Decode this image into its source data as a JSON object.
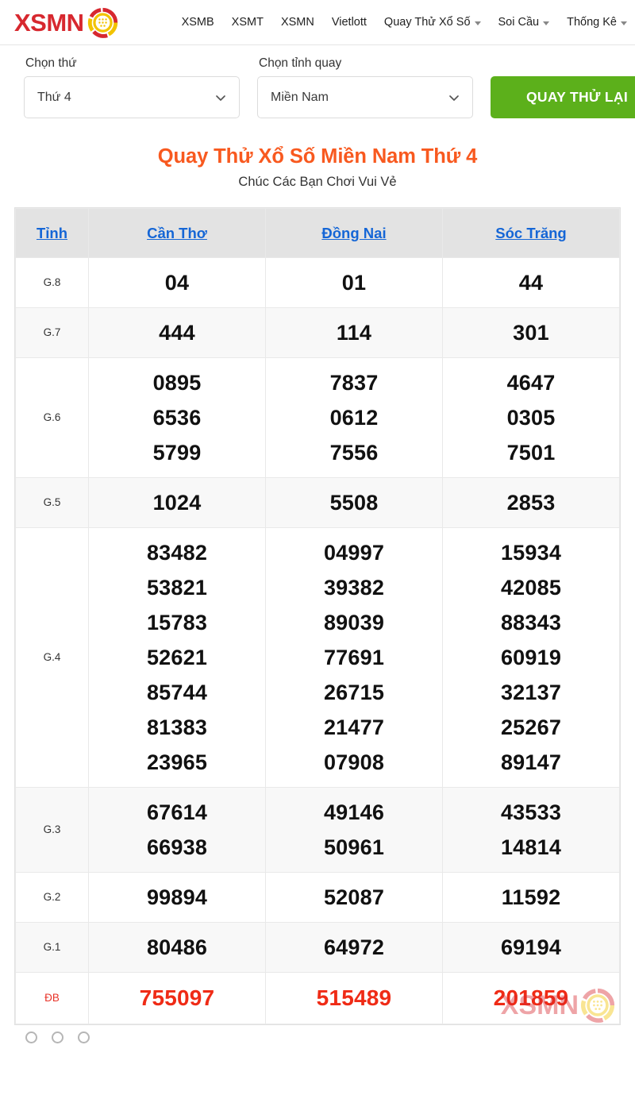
{
  "header": {
    "logo_text": "XSMN",
    "logo_icon": "lottery-ball-icon",
    "nav": [
      {
        "label": "XSMB",
        "has_caret": false
      },
      {
        "label": "XSMT",
        "has_caret": false
      },
      {
        "label": "XSMN",
        "has_caret": false
      },
      {
        "label": "Vietlott",
        "has_caret": false
      },
      {
        "label": "Quay Thử Xổ Số",
        "has_caret": true
      },
      {
        "label": "Soi Cầu",
        "has_caret": true
      },
      {
        "label": "Thống Kê",
        "has_caret": true
      }
    ]
  },
  "filters": {
    "day": {
      "label": "Chọn thứ",
      "value": "Thứ 4",
      "icon": "chevron-down-icon"
    },
    "province": {
      "label": "Chọn tỉnh quay",
      "value": "Miền Nam",
      "icon": "chevron-down-icon"
    },
    "spin_button": "QUAY THỬ LẠI"
  },
  "page": {
    "title": "Quay Thử Xổ Số Miền Nam Thứ 4",
    "subtitle": "Chúc Các Bạn Chơi Vui Vẻ"
  },
  "results_table": {
    "headers": [
      "Tỉnh",
      "Cần Thơ",
      "Đồng Nai",
      "Sóc Trăng"
    ],
    "rows": [
      {
        "prize": "G.8",
        "values": [
          [
            "04"
          ],
          [
            "01"
          ],
          [
            "44"
          ]
        ]
      },
      {
        "prize": "G.7",
        "values": [
          [
            "444"
          ],
          [
            "114"
          ],
          [
            "301"
          ]
        ]
      },
      {
        "prize": "G.6",
        "values": [
          [
            "0895",
            "6536",
            "5799"
          ],
          [
            "7837",
            "0612",
            "7556"
          ],
          [
            "4647",
            "0305",
            "7501"
          ]
        ]
      },
      {
        "prize": "G.5",
        "values": [
          [
            "1024"
          ],
          [
            "5508"
          ],
          [
            "2853"
          ]
        ]
      },
      {
        "prize": "G.4",
        "values": [
          [
            "83482",
            "53821",
            "15783",
            "52621",
            "85744",
            "81383",
            "23965"
          ],
          [
            "04997",
            "39382",
            "89039",
            "77691",
            "26715",
            "21477",
            "07908"
          ],
          [
            "15934",
            "42085",
            "88343",
            "60919",
            "32137",
            "25267",
            "89147"
          ]
        ]
      },
      {
        "prize": "G.3",
        "values": [
          [
            "67614",
            "66938"
          ],
          [
            "49146",
            "50961"
          ],
          [
            "43533",
            "14814"
          ]
        ]
      },
      {
        "prize": "G.2",
        "values": [
          [
            "99894"
          ],
          [
            "52087"
          ],
          [
            "11592"
          ]
        ]
      },
      {
        "prize": "G.1",
        "values": [
          [
            "80486"
          ],
          [
            "64972"
          ],
          [
            "69194"
          ]
        ]
      },
      {
        "prize": "ĐB",
        "is_special": true,
        "values": [
          [
            "755097"
          ],
          [
            "515489"
          ],
          [
            "201859"
          ]
        ]
      }
    ]
  },
  "watermark": {
    "text": "XSMN",
    "icon": "lottery-ball-icon"
  },
  "colors": {
    "brand_red": "#d7282f",
    "title_orange": "#f8591f",
    "button_green": "#5cb01b",
    "link_blue": "#1566d6",
    "special_red": "#ef2b16",
    "header_gray": "#e3e3e3"
  }
}
